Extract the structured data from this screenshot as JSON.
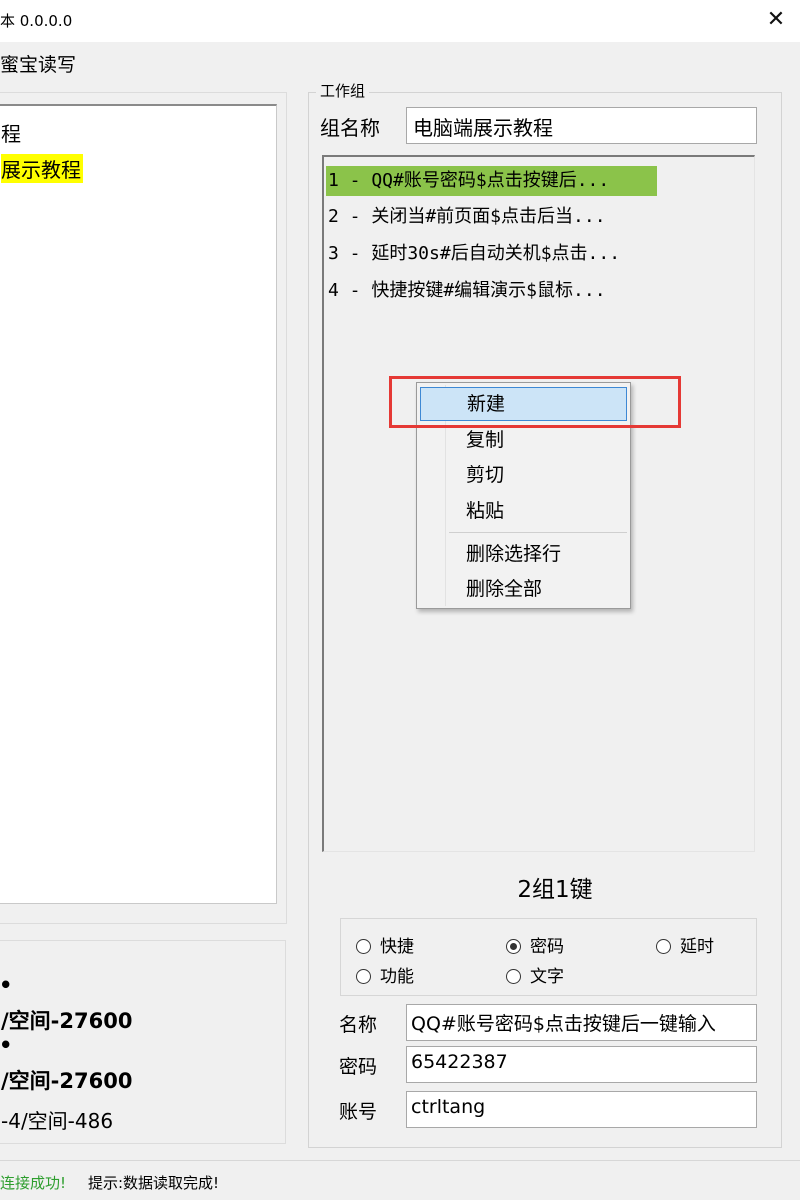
{
  "window": {
    "title": "本 0.0.0.0",
    "close_glyph": "✕"
  },
  "menu": {
    "item": "蜜宝读写"
  },
  "tree": {
    "items": [
      "程",
      "展示教程"
    ]
  },
  "info": {
    "lines": [
      "•",
      "/空间-27600",
      "•",
      "/空间-27600",
      "-4/空间-486"
    ]
  },
  "group": {
    "box_title": "工作组",
    "name_label": "组名称",
    "name_value": "电脑端展示教程"
  },
  "list": {
    "rows": [
      "1 - QQ#账号密码$点击按键后...",
      "2 - 关闭当#前页面$点击后当...",
      "3 - 延时30s#后自动关机$点击...",
      "4 - 快捷按键#编辑演示$鼠标..."
    ]
  },
  "context_menu": {
    "items": [
      "新建",
      "复制",
      "剪切",
      "粘贴",
      "删除选择行",
      "删除全部"
    ]
  },
  "counter": "2组1键",
  "radios": {
    "options": [
      "快捷",
      "密码",
      "延时",
      "功能",
      "文字"
    ],
    "selected": "密码"
  },
  "fields": {
    "name_label": "名称",
    "name_value": "QQ#账号密码$点击按键后一键输入",
    "password_label": "密码",
    "password_value": "65422387",
    "account_label": "账号",
    "account_value": "ctrltang"
  },
  "status": {
    "connection": "连接成功!",
    "tip": "提示:数据读取完成!"
  },
  "colors": {
    "selected_row": "#8bc34a",
    "tree_highlight": "#ffff00",
    "menu_hover": "#cce4f7",
    "annotation": "#e53935",
    "status_ok": "#2e9e2e"
  }
}
